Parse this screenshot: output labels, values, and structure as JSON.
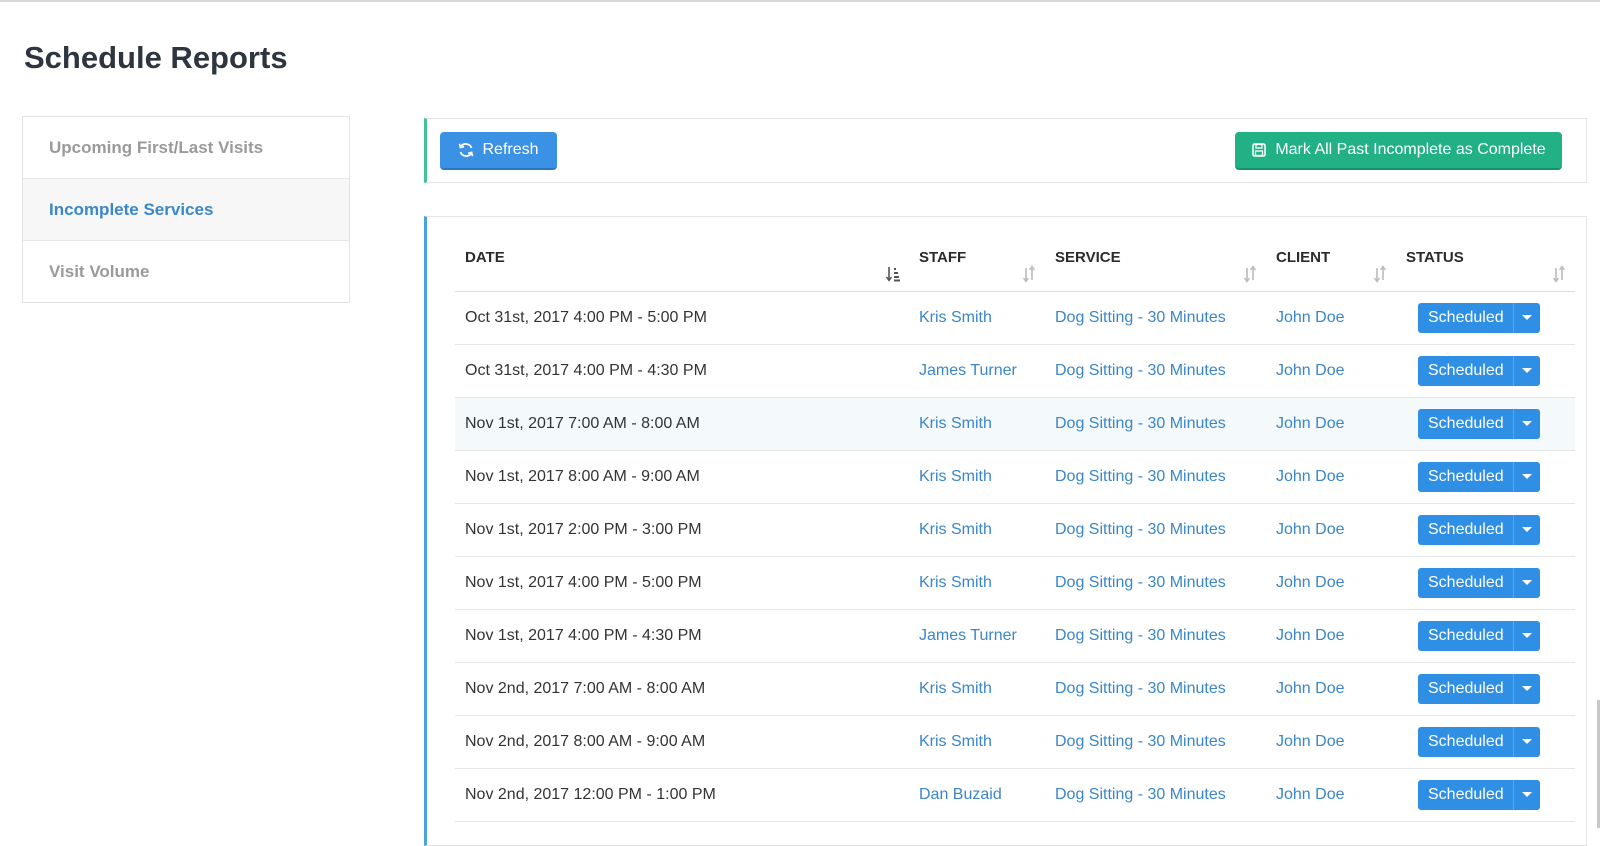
{
  "page": {
    "title": "Schedule Reports"
  },
  "sidebar": {
    "items": [
      {
        "label": "Upcoming First/Last Visits",
        "active": false
      },
      {
        "label": "Incomplete Services",
        "active": true
      },
      {
        "label": "Visit Volume",
        "active": false
      }
    ]
  },
  "toolbar": {
    "refresh_label": "Refresh",
    "complete_label": "Mark All Past Incomplete as Complete"
  },
  "table": {
    "columns": {
      "date": "DATE",
      "staff": "STAFF",
      "service": "SERVICE",
      "client": "CLIENT",
      "status": "STATUS"
    },
    "rows": [
      {
        "date": "Oct 31st, 2017 4:00 PM - 5:00 PM",
        "staff": "Kris Smith",
        "service": "Dog Sitting - 30 Minutes",
        "client": "John Doe",
        "status": "Scheduled"
      },
      {
        "date": "Oct 31st, 2017 4:00 PM - 4:30 PM",
        "staff": "James Turner",
        "service": "Dog Sitting - 30 Minutes",
        "client": "John Doe",
        "status": "Scheduled"
      },
      {
        "date": "Nov 1st, 2017 7:00 AM - 8:00 AM",
        "staff": "Kris Smith",
        "service": "Dog Sitting - 30 Minutes",
        "client": "John Doe",
        "status": "Scheduled"
      },
      {
        "date": "Nov 1st, 2017 8:00 AM - 9:00 AM",
        "staff": "Kris Smith",
        "service": "Dog Sitting - 30 Minutes",
        "client": "John Doe",
        "status": "Scheduled"
      },
      {
        "date": "Nov 1st, 2017 2:00 PM - 3:00 PM",
        "staff": "Kris Smith",
        "service": "Dog Sitting - 30 Minutes",
        "client": "John Doe",
        "status": "Scheduled"
      },
      {
        "date": "Nov 1st, 2017 4:00 PM - 5:00 PM",
        "staff": "Kris Smith",
        "service": "Dog Sitting - 30 Minutes",
        "client": "John Doe",
        "status": "Scheduled"
      },
      {
        "date": "Nov 1st, 2017 4:00 PM - 4:30 PM",
        "staff": "James Turner",
        "service": "Dog Sitting - 30 Minutes",
        "client": "John Doe",
        "status": "Scheduled"
      },
      {
        "date": "Nov 2nd, 2017 7:00 AM - 8:00 AM",
        "staff": "Kris Smith",
        "service": "Dog Sitting - 30 Minutes",
        "client": "John Doe",
        "status": "Scheduled"
      },
      {
        "date": "Nov 2nd, 2017 8:00 AM - 9:00 AM",
        "staff": "Kris Smith",
        "service": "Dog Sitting - 30 Minutes",
        "client": "John Doe",
        "status": "Scheduled"
      },
      {
        "date": "Nov 2nd, 2017 12:00 PM - 1:00 PM",
        "staff": "Dan Buzaid",
        "service": "Dog Sitting - 30 Minutes",
        "client": "John Doe",
        "status": "Scheduled"
      }
    ]
  },
  "icons": {
    "refresh": "refresh-icon",
    "save": "save-icon",
    "sort_active": "sort-amount-down-icon",
    "sort": "sort-icon",
    "caret": "caret-down-icon"
  },
  "colors": {
    "primary": "#3b92e4",
    "success": "#21b184",
    "link": "#3a86c8",
    "title": "#2d3540"
  }
}
